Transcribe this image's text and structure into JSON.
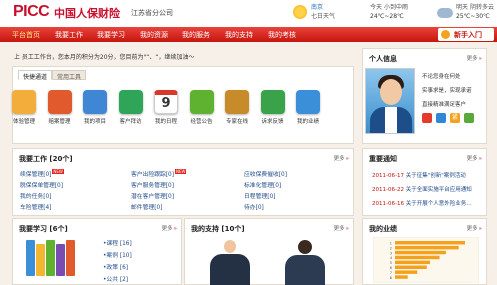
{
  "header": {
    "logo": "PICC",
    "company": "中国人保财险",
    "branch": "江苏省分公司",
    "weather": [
      {
        "city": "南京",
        "date": "七日天气",
        "day": "今天",
        "condition": "小到中雨",
        "temp": "24℃~28℃",
        "icon": "sun-cloud-icon"
      },
      {
        "day": "明天",
        "condition": "阴转多云",
        "temp": "25℃~30℃",
        "icon": "cloud-icon"
      }
    ]
  },
  "nav": {
    "items": [
      "平台首页",
      "我要工作",
      "我要学习",
      "我的资源",
      "我的服务",
      "我的支持",
      "我的考核"
    ],
    "guide": "新手入门"
  },
  "welcome": {
    "text": "上 员工工作台，您本月的积分为20分，您目前为\"“、“，继续加油～",
    "count": "20"
  },
  "quick": {
    "tabs": [
      "快捷通道",
      "常用工具"
    ],
    "apps": [
      {
        "label": "体验管理",
        "color": "#f3ad3b",
        "icon": "briefcase-icon"
      },
      {
        "label": "赔案管理",
        "color": "#e05a2d",
        "icon": "folder-icon"
      },
      {
        "label": "我的项目",
        "color": "#3f86d4",
        "icon": "tablet-icon"
      },
      {
        "label": "客户拜访",
        "color": "#2fa55a",
        "icon": "runner-icon"
      },
      {
        "label": "我的日程",
        "color": "#e7e3da",
        "icon": "calendar-icon",
        "day": "9"
      },
      {
        "label": "经营公告",
        "color": "#5fb130",
        "icon": "signal-icon"
      },
      {
        "label": "专家在线",
        "color": "#c88b2a",
        "icon": "expert-icon"
      },
      {
        "label": "诉求反馈",
        "color": "#3aa34a",
        "icon": "phone-icon"
      },
      {
        "label": "我的业绩",
        "color": "#3b8fd9",
        "icon": "chart-icon"
      }
    ]
  },
  "work": {
    "title": "我要工作 [20个]",
    "more": "更多",
    "items": [
      {
        "text": "续保管理[0]",
        "new": true
      },
      {
        "text": "客户出险跟踪[0]",
        "new": true
      },
      {
        "text": "应收保费催收[0]",
        "new": false
      },
      {
        "text": "脱保保单管理[0]",
        "new": false
      },
      {
        "text": "客户服务管理[0]",
        "new": false
      },
      {
        "text": "标准化管理[0]",
        "new": false
      },
      {
        "text": "我的任务[0]",
        "new": false
      },
      {
        "text": "潜在客户管理[0]",
        "new": false
      },
      {
        "text": "日程管理[0]",
        "new": false
      },
      {
        "text": "车险管理[4]",
        "new": false
      },
      {
        "text": "邮件管理[0]",
        "new": false
      },
      {
        "text": "待办[0]",
        "new": false
      }
    ]
  },
  "profile": {
    "title": "个人信息",
    "more": "更多",
    "lines": [
      "不论您身在何处",
      "实事求是，实现承诺",
      "直接精准满足客户"
    ],
    "badge": "紧"
  },
  "notices": {
    "title": "重要通知",
    "more": "更多",
    "items": [
      {
        "date": "2011-06-17",
        "text": "关于征集\"创新\"案例活动"
      },
      {
        "date": "2011-06-22",
        "text": "关于全面实施平台应用通知"
      },
      {
        "date": "2011-06-16",
        "text": "关于开展个人意外险业务…"
      }
    ]
  },
  "study": {
    "title": "我要学习 [6个]",
    "more": "更多",
    "items": [
      "•课程 [16]",
      "•案例 [10]",
      "•政策 [6]",
      "•公共 [2]"
    ],
    "books": [
      "#3b8fd9",
      "#f2b632",
      "#5fb130",
      "#7a4cb1",
      "#e05a2d"
    ]
  },
  "support": {
    "title": "我的支持 [10个]",
    "more": "更多"
  },
  "performance": {
    "title": "我的业绩",
    "more": "更多"
  },
  "chart_data": {
    "type": "bar",
    "categories": [
      "1",
      "2",
      "3",
      "4",
      "5",
      "6",
      "7",
      "8"
    ],
    "values": [
      1.1,
      1.0,
      0.8,
      0.7,
      0.55,
      0.5,
      0.35,
      0.2
    ],
    "colors": [
      "#f4a21d",
      "#f4a21d",
      "#f4a21d",
      "#f4a21d",
      "#f4a21d",
      "#f4a21d",
      "#f4a21d",
      "#f4a21d"
    ]
  }
}
